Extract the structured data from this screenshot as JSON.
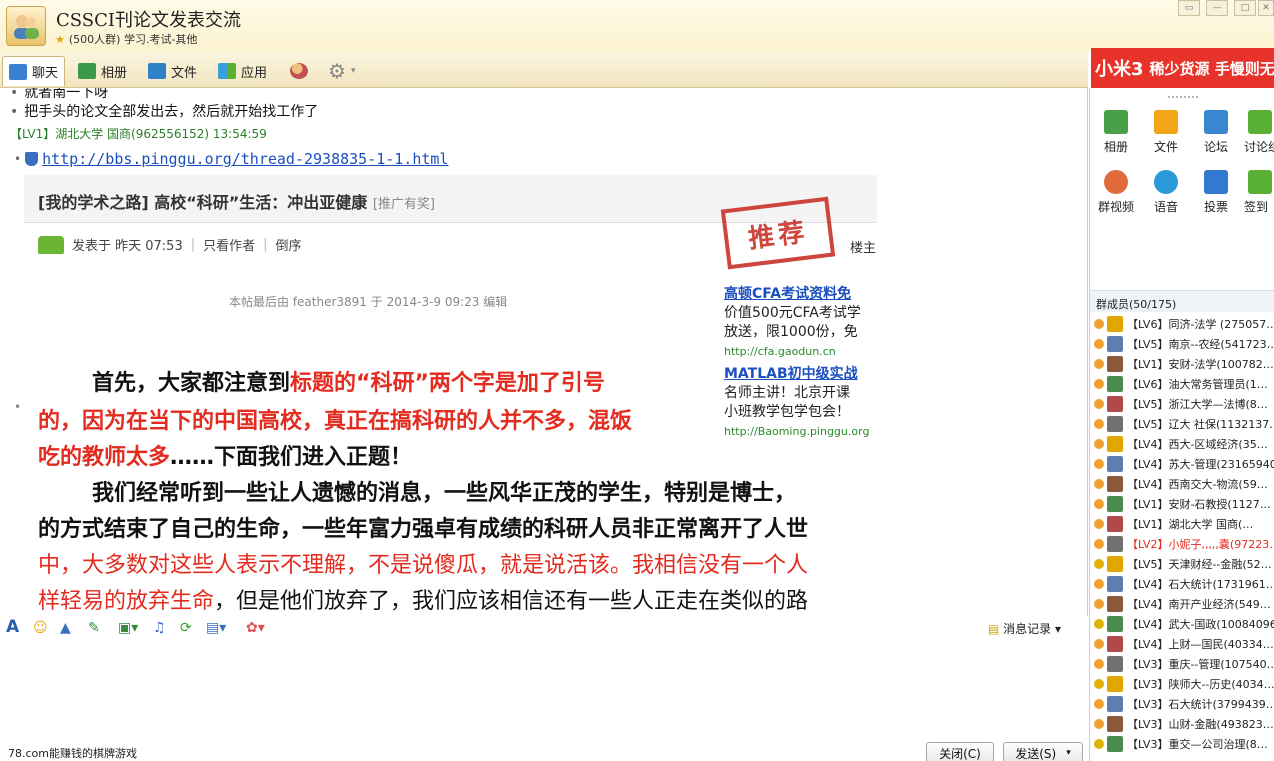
{
  "window": {
    "title": "CSSCI刊论文发表交流",
    "subtitle": "(500人群) 学习.考试-其他"
  },
  "toolbar": {
    "tabs": [
      {
        "label": "聊天",
        "icon": "chat-icon",
        "color": "#3a7fd0"
      },
      {
        "label": "相册",
        "icon": "photo-album-icon",
        "color": "#3a9a4a"
      },
      {
        "label": "文件",
        "icon": "folder-icon",
        "color": "#2f82c8"
      },
      {
        "label": "应用",
        "icon": "apps-icon",
        "color": "#3aa0d8"
      }
    ]
  },
  "ad_banner": {
    "brand": "小米3",
    "text": "稀少货源 手慢则无"
  },
  "chat": {
    "line1": "就者南一下呀",
    "line2": "把手头的论文全部发出去，然后就开始找工作了",
    "sender": "【LV1】湖北大学 国商(962556152)  13:54:59",
    "link": "http://bbs.pinggu.org/thread-2938835-1-1.html",
    "preview": {
      "title": "[我的学术之路] 高校“科研”生活：冲出亚健康",
      "title_tag": "[推广有奖]",
      "meta": [
        "发表于 昨天 07:53",
        "只看作者",
        "倒序"
      ],
      "stamp": "推荐",
      "floor": "楼主",
      "last_edit": "本帖最后由 feather3891 于 2014-3-9 09:23 编辑",
      "ads": [
        {
          "title": "高顿CFA考试资料免",
          "line": "价值500元CFA考试学",
          "line2": "放送，限1000份，免",
          "url": "http://cfa.gaodun.cn"
        },
        {
          "title": "MATLAB初中级实战",
          "line": "名师主讲！北京开课",
          "line2": "小班教学包学包会！",
          "url": "http://Baoming.pinggu.org"
        }
      ],
      "p1a": "首先，大家都注意到",
      "p1b": "标题的“科研”两个字是加了引号",
      "p1c": "的，因为在当下的中国高校，真正在搞科研的人并不多，混饭",
      "p1d": "吃的教师太多",
      "p1e": "……下面我们进入正题！",
      "p2a": "我们经常听到一些让人遗憾的消息，一些风华正茂的学生，特别是博士，",
      "p2b": "的方式结束了自己的生命，一些年富力强卓有成绩的科研人员非正常离开了人世",
      "p2c": "中，大多数对这些人表示不理解，不是说傻瓜，就是说活该。我相信没有一个人",
      "p2d": "样轻易的放弃生命",
      "p2e": "，但是他们放弃了，我们应该相信还有一些人正走在类似的路"
    }
  },
  "input_toolbar": {
    "history_label": "消息记录"
  },
  "status": {
    "ad_text": "78.com能赚钱的棋牌游戏",
    "close_label": "关闭(C)",
    "send_label": "发送(S)"
  },
  "side": {
    "apps": [
      {
        "label": "相册",
        "color": "#4aa048"
      },
      {
        "label": "文件",
        "color": "#f2a516"
      },
      {
        "label": "论坛",
        "color": "#3a86d0"
      },
      {
        "label": "讨论组",
        "color": "#5ab035"
      },
      {
        "label": "群视频",
        "color": "#e06a3a"
      },
      {
        "label": "语音",
        "color": "#2a9ad8"
      },
      {
        "label": "投票",
        "color": "#3478d0"
      },
      {
        "label": "签到",
        "color": "#5ab035"
      }
    ],
    "members_header": "群成员(50/175)",
    "members": [
      {
        "name": "【LV6】同济-法学 (275057…"
      },
      {
        "name": "【LV5】南京--农经(541723…"
      },
      {
        "name": "【LV1】安财-法学(100782…"
      },
      {
        "name": "【LV6】油大常务管理员(1…"
      },
      {
        "name": "【LV5】浙江大学—法博(8…"
      },
      {
        "name": "【LV5】辽大 社保(1132137…"
      },
      {
        "name": "【LV4】西大-区域经济(35…"
      },
      {
        "name": "【LV4】苏大-管理(23165940)"
      },
      {
        "name": "【LV4】西南交大-物流(59…"
      },
      {
        "name": "【LV1】安财-石教授(1127…"
      },
      {
        "name": "【LV1】湖北大学 国商(…"
      },
      {
        "name": "【LV2】小妮子,,,,,嚢(97223…",
        "highlight": true
      },
      {
        "name": "【LV5】天津财经--金融(52…"
      },
      {
        "name": "【LV4】石大统计(1731961…"
      },
      {
        "name": "【LV4】南开产业经济(549…"
      },
      {
        "name": "【LV4】武大-国政(10084096)"
      },
      {
        "name": "【LV4】上财—国民(40334…"
      },
      {
        "name": "【LV3】重庆--管理(107540…"
      },
      {
        "name": "【LV3】陕师大--历史(4034…"
      },
      {
        "name": "【LV3】石大统计(3799439…"
      },
      {
        "name": "【LV3】山财-金融(493823…"
      },
      {
        "name": "【LV3】重交—公司治理(8…"
      }
    ]
  }
}
